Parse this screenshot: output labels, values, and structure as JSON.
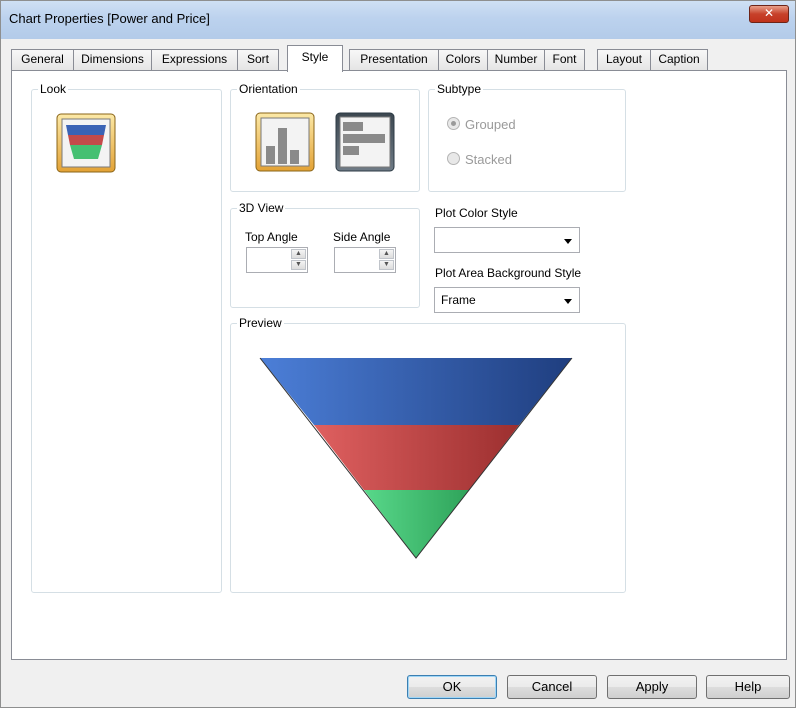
{
  "window": {
    "title": "Chart Properties [Power and Price]",
    "close_glyph": "✕"
  },
  "tabs": [
    {
      "label": "General"
    },
    {
      "label": "Dimensions"
    },
    {
      "label": "Expressions"
    },
    {
      "label": "Sort"
    },
    {
      "label": "Style",
      "active": true
    },
    {
      "label": "Presentation"
    },
    {
      "label": "Colors"
    },
    {
      "label": "Number"
    },
    {
      "label": "Font"
    },
    {
      "label": "Layout"
    },
    {
      "label": "Caption"
    }
  ],
  "style_tab": {
    "look": {
      "label": "Look",
      "selected_icon": "funnel-chart-icon"
    },
    "orientation": {
      "label": "Orientation",
      "options": [
        {
          "icon": "vertical-bars-icon",
          "selected": true
        },
        {
          "icon": "horizontal-bars-icon",
          "selected": false
        }
      ]
    },
    "subtype": {
      "label": "Subtype",
      "options": [
        {
          "label": "Grouped",
          "selected": true,
          "disabled": true
        },
        {
          "label": "Stacked",
          "selected": false,
          "disabled": true
        }
      ]
    },
    "view3d": {
      "label": "3D View",
      "top_angle_label": "Top Angle",
      "side_angle_label": "Side Angle",
      "top_angle_value": "",
      "side_angle_value": ""
    },
    "plot_color_style": {
      "label": "Plot Color Style",
      "value": ""
    },
    "plot_area_bg_style": {
      "label": "Plot Area Background Style",
      "value": "Frame"
    },
    "preview": {
      "label": "Preview",
      "funnel_colors": [
        "#3a63b5",
        "#c44a4a",
        "#45c072"
      ]
    }
  },
  "buttons": {
    "ok": "OK",
    "cancel": "Cancel",
    "apply": "Apply",
    "help": "Help"
  }
}
